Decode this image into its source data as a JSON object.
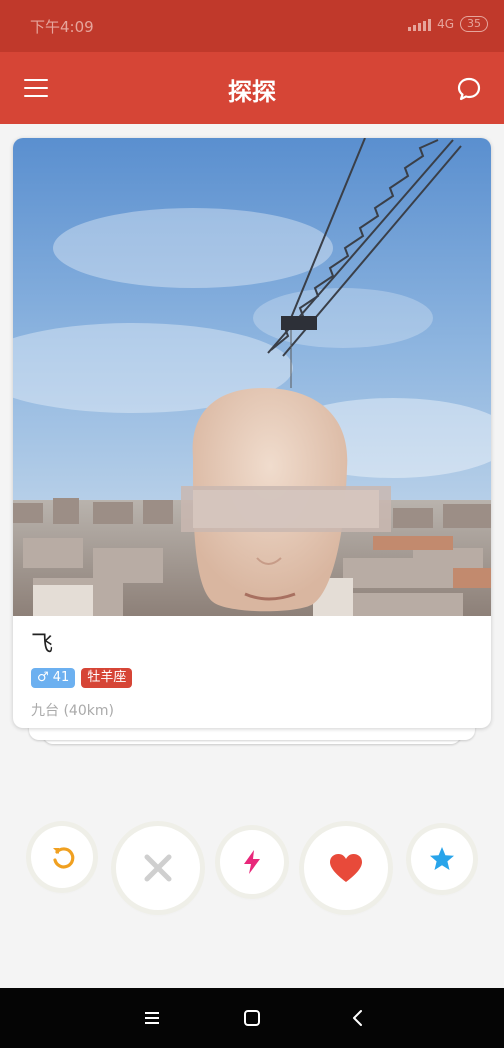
{
  "status_bar": {
    "time": "下午4:09",
    "network": "4G",
    "battery": "35"
  },
  "header": {
    "title": "探探",
    "menu_icon": "hamburger-menu-icon",
    "chat_icon": "chat-bubble-icon"
  },
  "profile": {
    "name": "飞",
    "gender_symbol": "♂",
    "age": "41",
    "gender_tag": "♂ 41",
    "zodiac": "牡羊座",
    "location": "九台 (40km)"
  },
  "actions": [
    {
      "name": "undo",
      "icon": "undo-icon",
      "color": "#f0a020"
    },
    {
      "name": "dislike",
      "icon": "close-icon",
      "color": "#cfcfcf"
    },
    {
      "name": "boost",
      "icon": "lightning-icon",
      "color": "#e8287a"
    },
    {
      "name": "like",
      "icon": "heart-icon",
      "color": "#e84a3a"
    },
    {
      "name": "super-like",
      "icon": "star-icon",
      "color": "#28a4ea"
    }
  ],
  "system_nav": {
    "menu_icon": "recents-icon",
    "home_icon": "home-icon",
    "back_icon": "back-icon"
  },
  "colors": {
    "status_bar": "#c0392b",
    "app_bar": "#d64536",
    "gender_tag": "#6cb0f0",
    "zodiac_tag": "#d64536"
  }
}
